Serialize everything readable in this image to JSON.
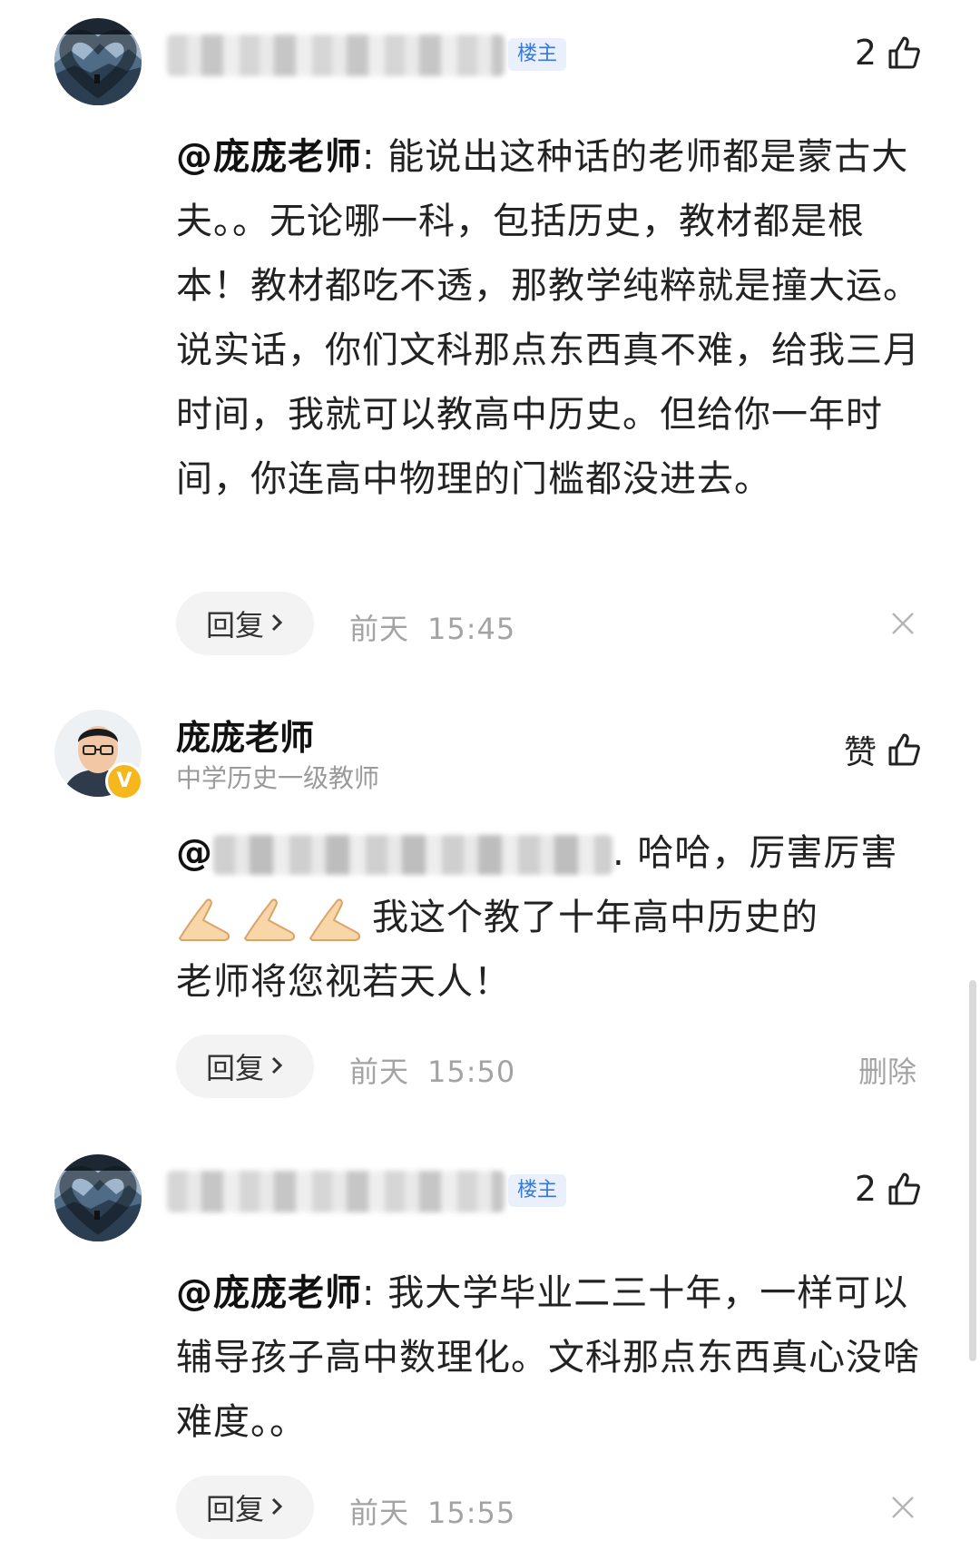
{
  "comments": [
    {
      "badge": "楼主",
      "likes": "2",
      "mention": "@庞庞老师",
      "text": ": 能说出这种话的老师都是蒙古大夫。。无论哪一科，包括历史，教材都是根本！教材都吃不透，那教学纯粹就是撞大运。说实话，你们文科那点东西真不难，给我三月时间，我就可以教高中历史。但给你一年时间，你连高中物理的门槛都没进去。",
      "reply_label": "回复",
      "time_day": "前天",
      "time_clock": "15:45"
    },
    {
      "author": "庞庞老师",
      "author_title": "中学历史一级教师",
      "verified_mark": "V",
      "like_label": "赞",
      "mention": "@",
      "text_line1": ". 哈哈，厉害厉害",
      "text_line2": "我这个教了十年高中历史的",
      "text_line3": "老师将您视若天人！",
      "reply_label": "回复",
      "time_day": "前天",
      "time_clock": "15:50",
      "delete_label": "删除"
    },
    {
      "badge": "楼主",
      "likes": "2",
      "mention": "@庞庞老师",
      "text": ": 我大学毕业二三十年，一样可以辅导孩子高中数理化。文科那点东西真心没啥难度。。",
      "reply_label": "回复",
      "time_day": "前天",
      "time_clock": "15:55"
    }
  ]
}
